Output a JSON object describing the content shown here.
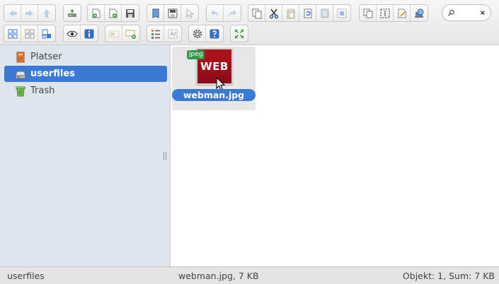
{
  "toolbar": {
    "icons": {
      "back": "arrow-left-icon",
      "forward": "arrow-right-icon",
      "up": "arrow-up-icon",
      "reload": "drive-reload-icon",
      "mkdir": "new-folder-icon",
      "mkfile": "new-file-icon",
      "save": "save-icon",
      "open": "open-icon",
      "download": "download-icon",
      "select": "select-pointer-icon",
      "undo": "undo-icon",
      "redo": "redo-icon",
      "copy": "copy-icon",
      "cut": "cut-icon",
      "paste": "paste-icon",
      "duplicate": "duplicate-icon",
      "rm": "delete-icon",
      "empty": "empty-icon",
      "selectall": "select-all-icon",
      "selectnone": "select-none-icon",
      "edit": "edit-icon",
      "netmount": "network-icon",
      "view_icons": "view-icons-icon",
      "view_small": "view-small-icons-icon",
      "view_list": "view-list-icon",
      "preview": "eye-icon",
      "info": "info-icon",
      "rename": "rename-icon",
      "resize": "resize-icon",
      "sort": "sort-icon",
      "extract": "extract-icon",
      "settings": "gear-icon",
      "help": "help-icon",
      "fullscreen": "fullscreen-icon"
    },
    "search": {
      "placeholder": "",
      "value": "",
      "icon": "search-icon",
      "clear_icon": "close-icon"
    }
  },
  "sidebar": {
    "items": [
      {
        "label": "Platser",
        "icon": "places-icon",
        "active": false
      },
      {
        "label": "userfiles",
        "icon": "drive-icon",
        "active": true
      },
      {
        "label": "Trash",
        "icon": "trash-icon",
        "active": false
      }
    ]
  },
  "files": [
    {
      "name": "webman.jpg",
      "badge": "jpeg",
      "thumb_text": "WEB",
      "selected": true
    }
  ],
  "status": {
    "path": "userfiles",
    "selection": "webman.jpg, 7 KB",
    "summary": "Objekt: 1, Sum: 7 KB"
  },
  "colors": {
    "accent": "#3a79d6",
    "sidebar_bg": "#dfe5ec",
    "badge": "#2f9c4c",
    "thumb": "#b0121d"
  }
}
